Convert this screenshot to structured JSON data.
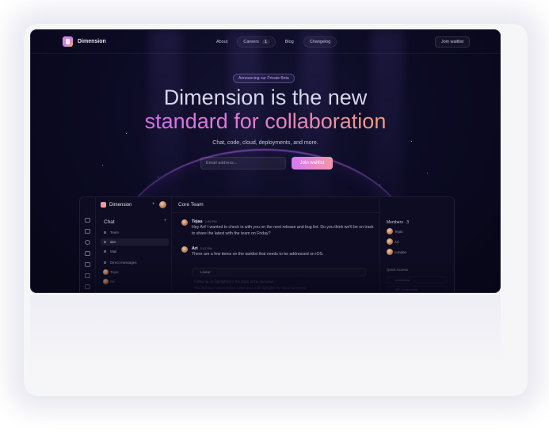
{
  "nav": {
    "brand": "Dimension",
    "links": [
      {
        "label": "About"
      },
      {
        "label": "Careers",
        "badge": "1"
      },
      {
        "label": "Blog"
      },
      {
        "label": "Changelog"
      }
    ],
    "cta": "Join waitlist"
  },
  "hero": {
    "announcement": "Announcing our Private Beta",
    "title_line1": "Dimension is the new",
    "title_line2": "standard for collaboration",
    "subtitle": "Chat, code, cloud, deployments, and more.",
    "email_placeholder": "Email address...",
    "join_button": "Join waitlist"
  },
  "app": {
    "workspace": "Dimension",
    "sidebar": {
      "title": "Chat",
      "items": [
        "Team",
        "dev",
        "Mail",
        "Direct messages",
        "Tejas",
        "Ari"
      ]
    },
    "channel": "Core Team",
    "messages": [
      {
        "author": "Tejas",
        "time": "2:45 PM",
        "text": "Hey Ari! I wanted to check in with you on the next release and bug list. Do you think we'll be on track to share the latest with the team on Friday?"
      },
      {
        "author": "Ari",
        "time": "2:47 PM",
        "text": "There are a few items on the tasklist that needs to be addressed on iOS."
      }
    ],
    "attachment": "Linear",
    "faint_lines": [
      "Follow up on highlighted in the stack at the 2nd wave",
      "The 2nd wave also involves some tests and highlights the follow up review"
    ],
    "members": {
      "title": "Members · 3",
      "list": [
        "Tejas",
        "Ari",
        "London"
      ],
      "quick_access_title": "Quick Access",
      "quick_access": [
        "Invitations",
        "API Credentials"
      ]
    }
  }
}
